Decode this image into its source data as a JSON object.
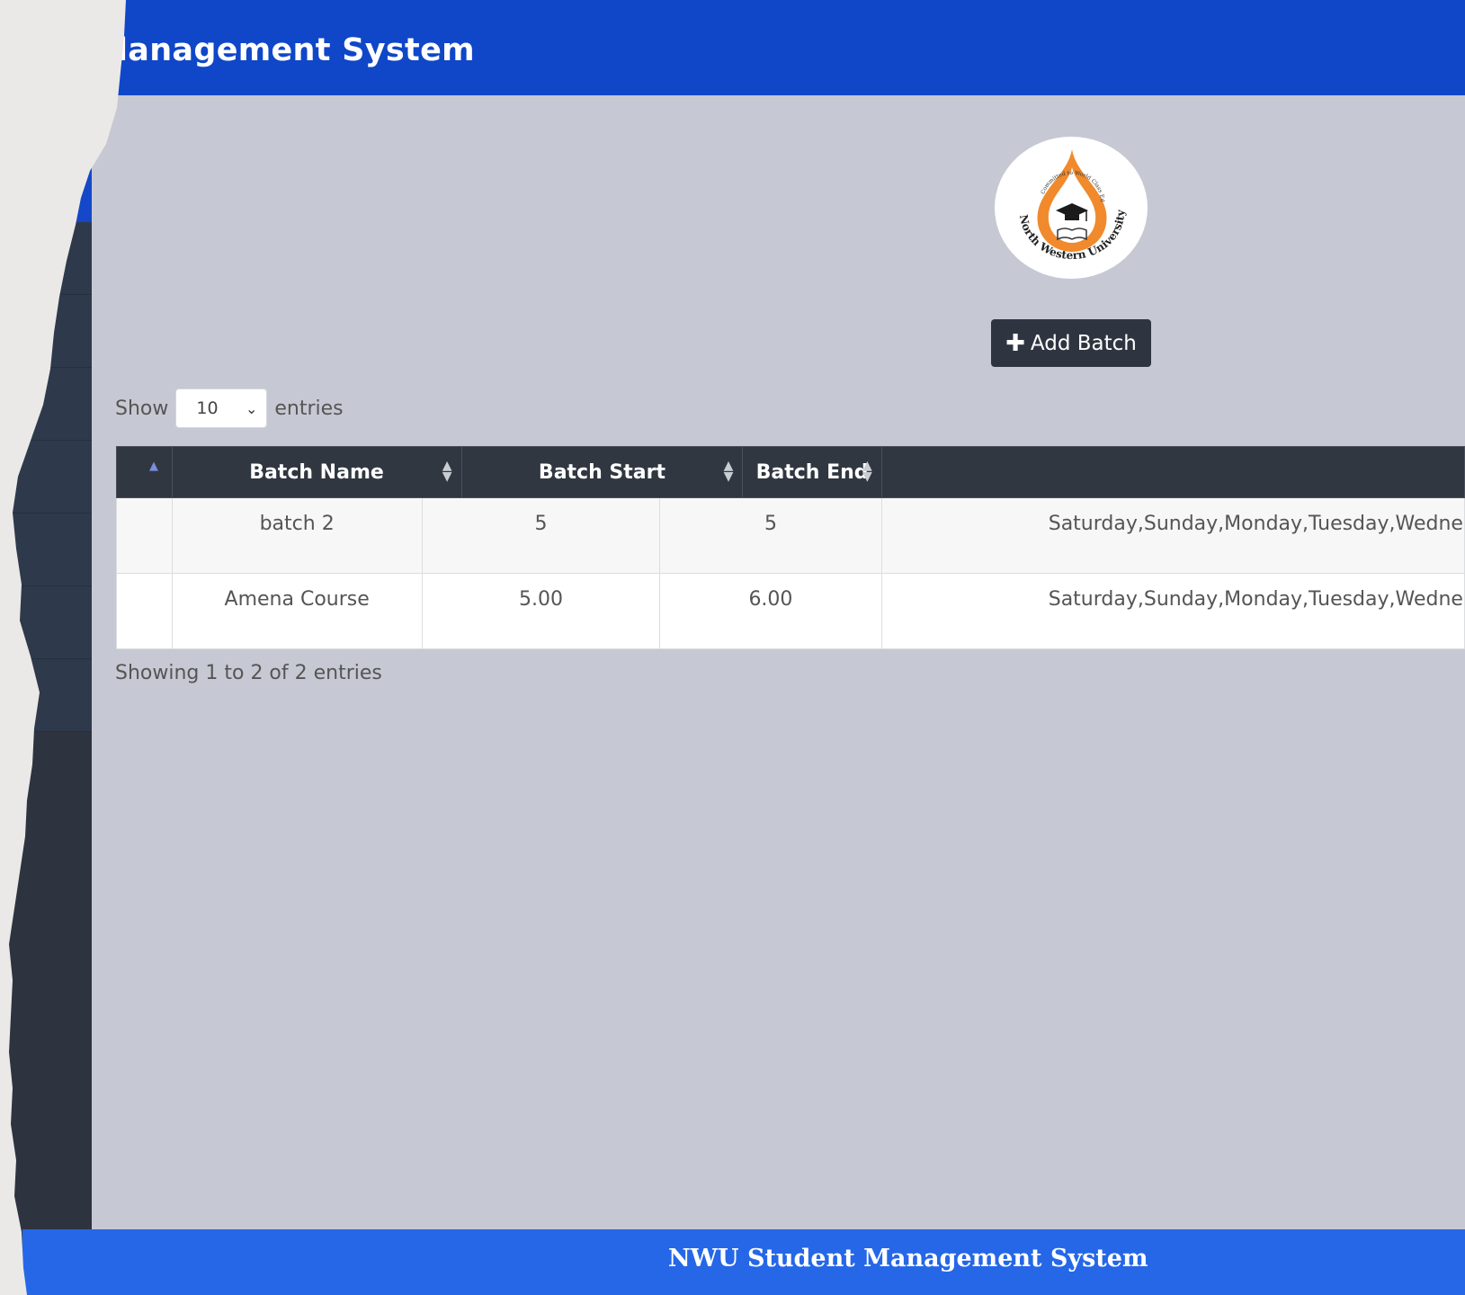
{
  "header": {
    "title": "lanagement System"
  },
  "logo": {
    "alt": "North Western University logo",
    "motto": "Committed to World Class Education",
    "name": "North Western University"
  },
  "toolbar": {
    "add_batch_label": "Add Batch"
  },
  "length_menu": {
    "show_label": "Show",
    "selected": "10",
    "entries_label": "entries"
  },
  "table": {
    "headers": [
      "",
      "Batch Name",
      "Batch Start",
      "Batch End",
      ""
    ],
    "rows": [
      {
        "num": "",
        "batch_name": "batch 2",
        "batch_start": "5",
        "batch_end": "5",
        "days": "Saturday,Sunday,Monday,Tuesday,Wedne"
      },
      {
        "num": "",
        "batch_name": "Amena Course",
        "batch_start": "5.00",
        "batch_end": "6.00",
        "days": "Saturday,Sunday,Monday,Tuesday,Wedne"
      }
    ]
  },
  "info": "Showing 1 to 2 of 2 entries",
  "footer": {
    "text": "NWU Student Management System"
  },
  "colors": {
    "topbar": "#0f47c8",
    "footer": "#2567e7",
    "sidebar": "#2d3440",
    "content_bg": "#c6c9d3",
    "header_row": "#303741"
  }
}
